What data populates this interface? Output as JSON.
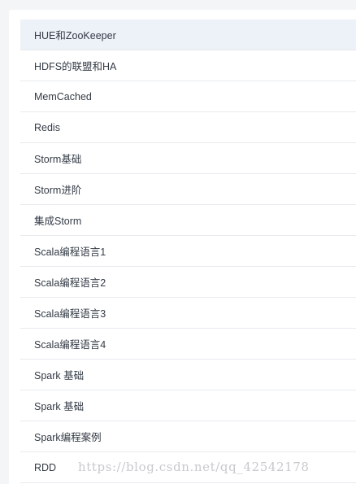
{
  "menu": {
    "items": [
      {
        "label": "HUE和ZooKeeper",
        "active": true
      },
      {
        "label": "HDFS的联盟和HA"
      },
      {
        "label": "MemCached"
      },
      {
        "label": "Redis"
      },
      {
        "label": "Storm基础"
      },
      {
        "label": "Storm进阶"
      },
      {
        "label": "集成Storm"
      },
      {
        "label": "Scala编程语言1"
      },
      {
        "label": "Scala编程语言2"
      },
      {
        "label": "Scala编程语言3"
      },
      {
        "label": "Scala编程语言4"
      },
      {
        "label": "Spark 基础"
      },
      {
        "label": "Spark 基础"
      },
      {
        "label": "Spark编程案例"
      },
      {
        "label": "RDD"
      }
    ]
  },
  "watermark": {
    "text": "https://blog.csdn.net/qq_42542178"
  },
  "colors": {
    "page_background": "#f4f5f7",
    "active_row": "#edf1f8",
    "divider": "#e8eaee",
    "text": "#333b45",
    "watermark": "#c7c9cc"
  }
}
